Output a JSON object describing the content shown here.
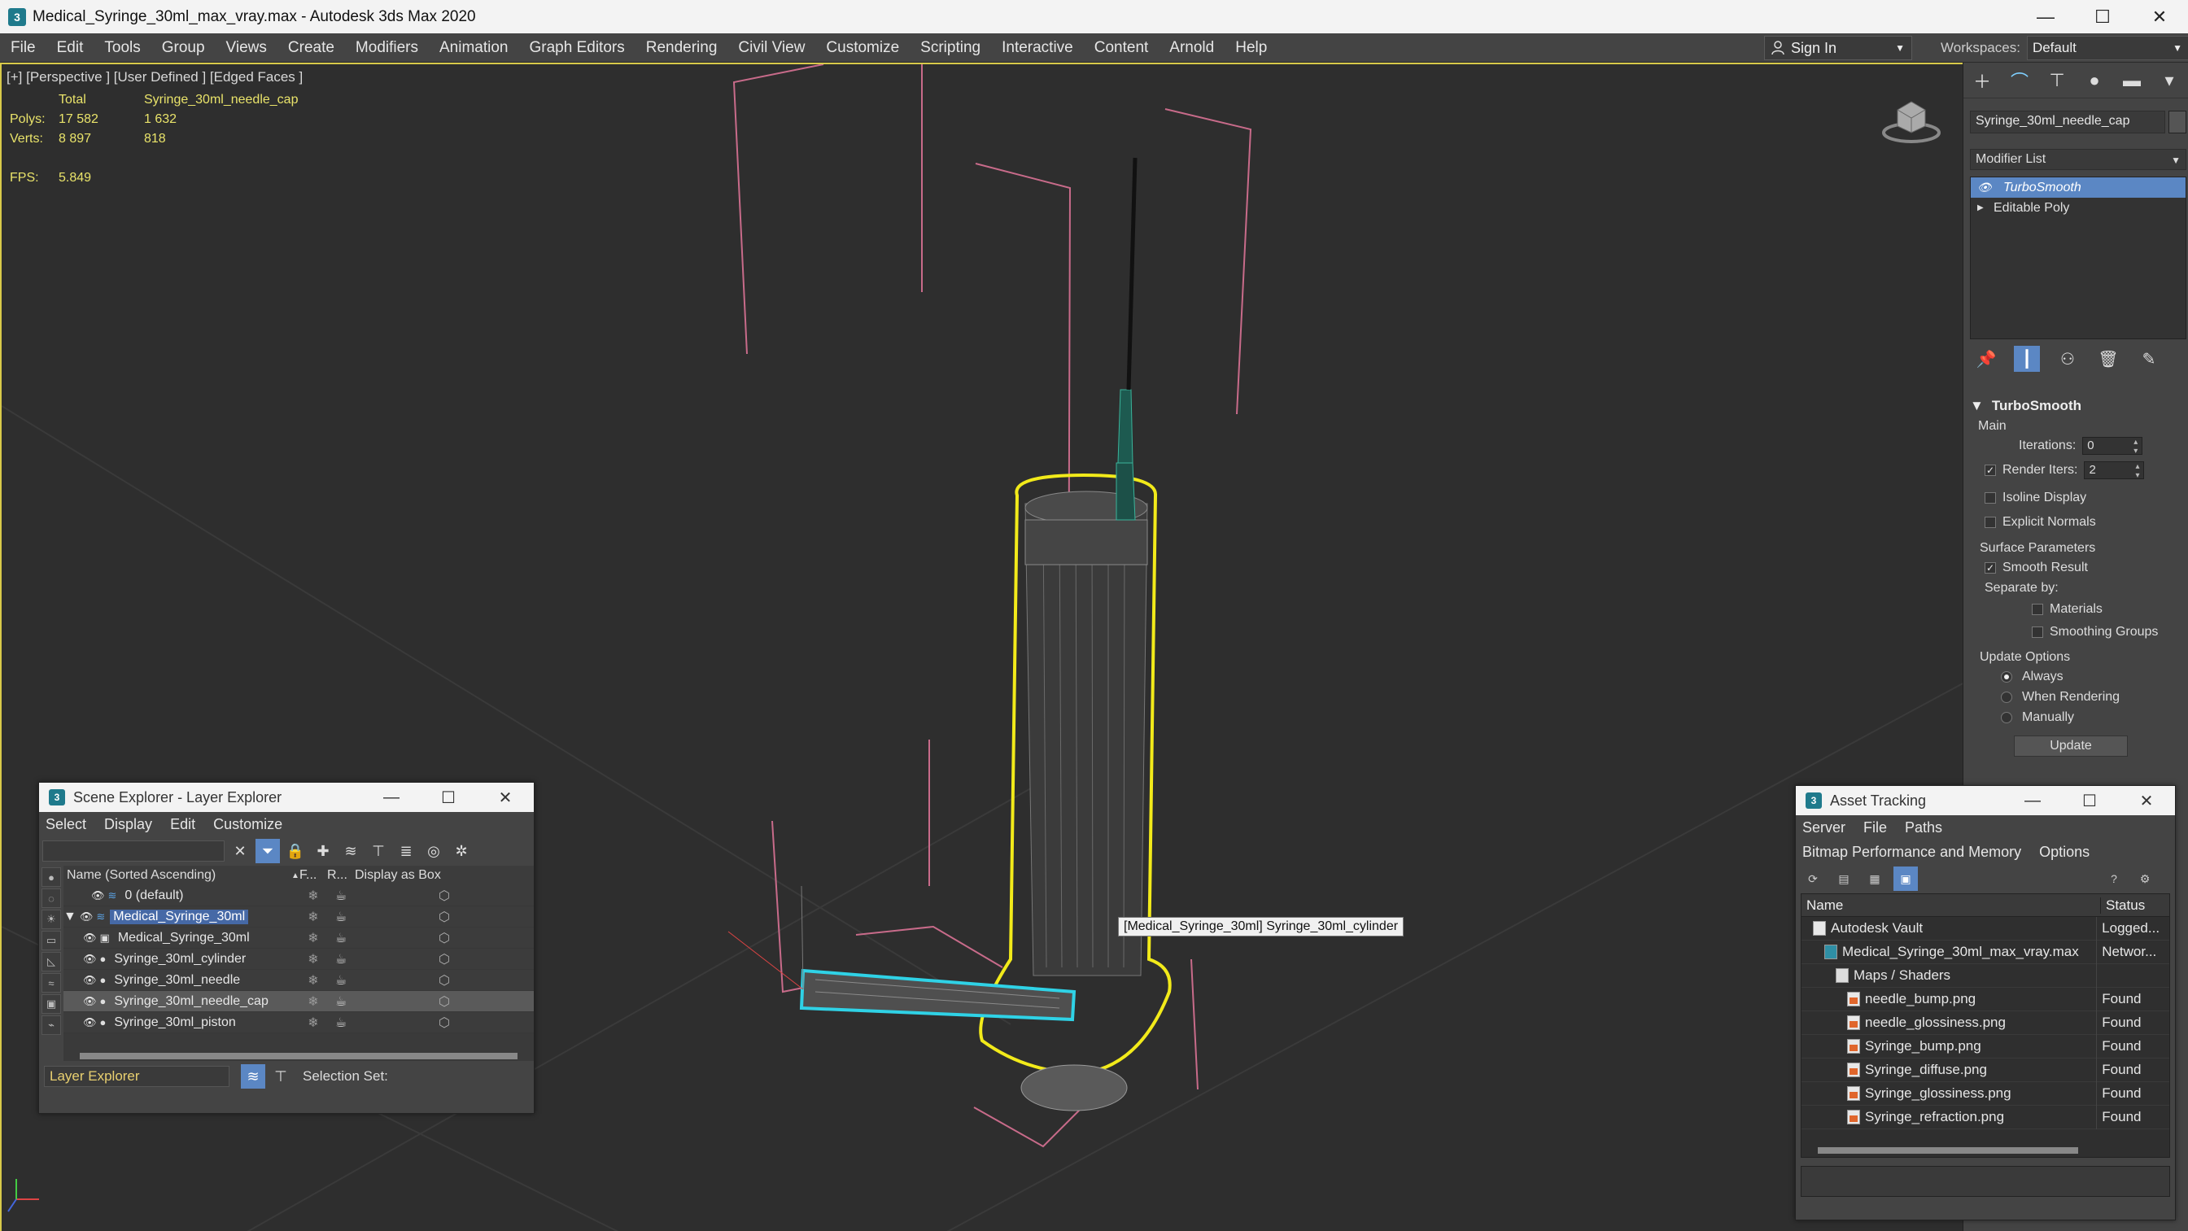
{
  "window": {
    "title": "Medical_Syringe_30ml_max_vray.max - Autodesk 3ds Max 2020",
    "min": "—",
    "max": "☐",
    "close": "✕"
  },
  "menu": [
    "File",
    "Edit",
    "Tools",
    "Group",
    "Views",
    "Create",
    "Modifiers",
    "Animation",
    "Graph Editors",
    "Rendering",
    "Civil View",
    "Customize",
    "Scripting",
    "Interactive",
    "Content",
    "Arnold",
    "Help"
  ],
  "signin": {
    "label": "Sign In"
  },
  "workspaces": {
    "label": "Workspaces:",
    "value": "Default"
  },
  "viewport": {
    "label": "[+] [Perspective ] [User Defined ] [Edged Faces ]",
    "stats": {
      "header_total": "Total",
      "header_object": "Syringe_30ml_needle_cap",
      "polys_label": "Polys:",
      "polys_total": "17 582",
      "polys_obj": "1 632",
      "verts_label": "Verts:",
      "verts_total": "8 897",
      "verts_obj": "818",
      "fps_label": "FPS:",
      "fps_value": "5.849"
    },
    "tooltip": "[Medical_Syringe_30ml] Syringe_30ml_cylinder",
    "selection_color": "#f2ea1a",
    "highlight_color": "#2fd2e6",
    "bbox_color": "#c86b8a"
  },
  "command_panel": {
    "object_name": "Syringe_30ml_needle_cap",
    "modifier_list": "Modifier List",
    "stack": [
      {
        "label": "TurboSmooth",
        "selected": true
      },
      {
        "label": "Editable Poly",
        "selected": false
      }
    ],
    "turbosmooth": {
      "title": "TurboSmooth",
      "main": "Main",
      "iterations_label": "Iterations:",
      "iterations_value": "0",
      "render_iters_label": "Render Iters:",
      "render_iters_value": "2",
      "isoline": "Isoline Display",
      "explicit": "Explicit Normals",
      "surface_params": "Surface Parameters",
      "smooth_result": "Smooth Result",
      "separate_by": "Separate by:",
      "materials": "Materials",
      "smoothing_groups": "Smoothing Groups",
      "update_options": "Update Options",
      "always": "Always",
      "when_rendering": "When Rendering",
      "manually": "Manually",
      "update": "Update"
    }
  },
  "scene_explorer": {
    "title": "Scene Explorer - Layer Explorer",
    "menu": [
      "Select",
      "Display",
      "Edit",
      "Customize"
    ],
    "col_name": "Name (Sorted Ascending)",
    "col_f": "F...",
    "col_r": "R...",
    "col_box": "Display as Box",
    "rows": [
      {
        "name": "0 (default)",
        "indent": 1,
        "type": "layer",
        "selected": false,
        "highlight": false
      },
      {
        "name": "Medical_Syringe_30ml",
        "indent": 0,
        "type": "layer",
        "selected": true,
        "highlight": true
      },
      {
        "name": "Medical_Syringe_30ml",
        "indent": 2,
        "type": "group",
        "selected": false,
        "highlight": false
      },
      {
        "name": "Syringe_30ml_cylinder",
        "indent": 2,
        "type": "object",
        "selected": false,
        "highlight": false
      },
      {
        "name": "Syringe_30ml_needle",
        "indent": 2,
        "type": "object",
        "selected": false,
        "highlight": false
      },
      {
        "name": "Syringe_30ml_needle_cap",
        "indent": 2,
        "type": "object",
        "selected": true,
        "highlight": false
      },
      {
        "name": "Syringe_30ml_piston",
        "indent": 2,
        "type": "object",
        "selected": false,
        "highlight": false
      }
    ],
    "layer_explorer": "Layer Explorer",
    "selection_set": "Selection Set:"
  },
  "asset_tracking": {
    "title": "Asset Tracking",
    "menu1": [
      "Server",
      "File",
      "Paths"
    ],
    "menu2": [
      "Bitmap Performance and Memory",
      "Options"
    ],
    "col_name": "Name",
    "col_status": "Status",
    "rows": [
      {
        "name": "Autodesk Vault",
        "status": "Logged...",
        "indent": 1,
        "icon": "vault"
      },
      {
        "name": "Medical_Syringe_30ml_max_vray.max",
        "status": "Networ...",
        "indent": 2,
        "icon": "max"
      },
      {
        "name": "Maps / Shaders",
        "status": "",
        "indent": 3,
        "icon": "folder"
      },
      {
        "name": "needle_bump.png",
        "status": "Found",
        "indent": 4,
        "icon": "img"
      },
      {
        "name": "needle_glossiness.png",
        "status": "Found",
        "indent": 4,
        "icon": "img"
      },
      {
        "name": "Syringe_bump.png",
        "status": "Found",
        "indent": 4,
        "icon": "img"
      },
      {
        "name": "Syringe_diffuse.png",
        "status": "Found",
        "indent": 4,
        "icon": "img"
      },
      {
        "name": "Syringe_glossiness.png",
        "status": "Found",
        "indent": 4,
        "icon": "img"
      },
      {
        "name": "Syringe_refraction.png",
        "status": "Found",
        "indent": 4,
        "icon": "img"
      }
    ]
  }
}
